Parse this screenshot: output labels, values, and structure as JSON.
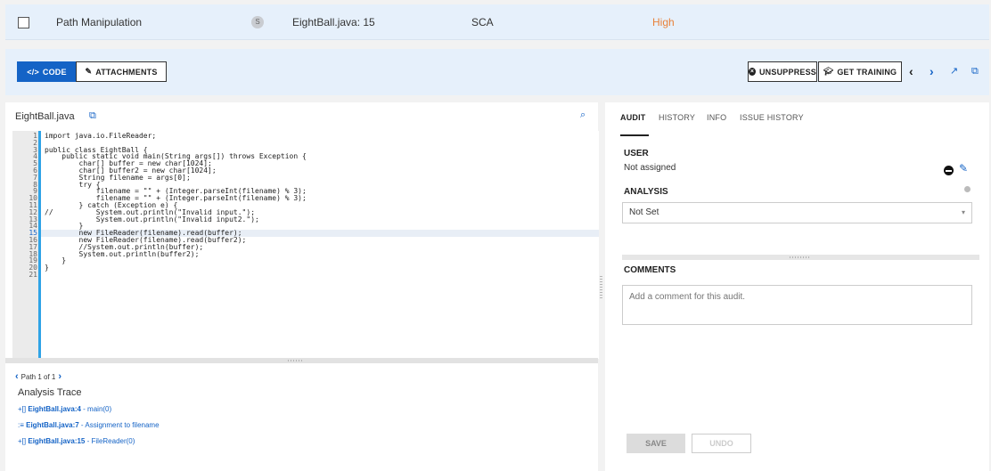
{
  "issue": {
    "category": "Path Manipulation",
    "severity_badge": "S",
    "location": "EightBall.java: 15",
    "type": "SCA",
    "priority": "High"
  },
  "colors": {
    "accent": "#1463c6",
    "priority_high": "#e8813a",
    "splitter_blue": "#2fa3e6"
  },
  "toolbar": {
    "code_label": "CODE",
    "attachments_label": "ATTACHMENTS",
    "unsuppress_label": "UNSUPPRESS",
    "training_label": "GET TRAINING",
    "prev_icon": "chevron-left",
    "next_icon": "chevron-right",
    "open_icon": "external-link",
    "copy_icon": "copy"
  },
  "code_panel": {
    "filename": "EightBall.java",
    "highlighted_line": 15,
    "lines": [
      "import java.io.FileReader;",
      "",
      "public class EightBall {",
      "    public static void main(String args[]) throws Exception {",
      "        char[] buffer = new char[1024];",
      "        char[] buffer2 = new char[1024];",
      "        String filename = args[0];",
      "        try {",
      "            filename = \"\" + (Integer.parseInt(filename) % 3);",
      "            filename = \"\" + (Integer.parseInt(filename) % 3);",
      "        } catch (Exception e) {",
      "//          System.out.println(\"Invalid input.\");",
      "            System.out.println(\"Invalid input2.\");",
      "        }",
      "        new FileReader(filename).read(buffer);",
      "        new FileReader(filename).read(buffer2);",
      "        //System.out.println(buffer);",
      "        System.out.println(buffer2);",
      "    }",
      "}",
      ""
    ]
  },
  "trace": {
    "path_label": "Path 1 of 1",
    "title": "Analysis Trace",
    "items": [
      {
        "icon": "+[]",
        "loc": "EightBall.java:4",
        "desc": " - main(0)"
      },
      {
        "icon": ":≡",
        "loc": "EightBall.java:7",
        "desc": " - Assignment to filename"
      },
      {
        "icon": "+[]",
        "loc": "EightBall.java:15",
        "desc": " - FileReader(0)"
      }
    ]
  },
  "audit": {
    "tabs": [
      "AUDIT",
      "HISTORY",
      "INFO",
      "ISSUE HISTORY"
    ],
    "user_label": "USER",
    "user_value": "Not assigned",
    "analysis_label": "ANALYSIS",
    "analysis_value": "Not Set",
    "comments_label": "COMMENTS",
    "comment_placeholder": "Add a comment for this audit.",
    "save_label": "SAVE",
    "undo_label": "UNDO"
  }
}
